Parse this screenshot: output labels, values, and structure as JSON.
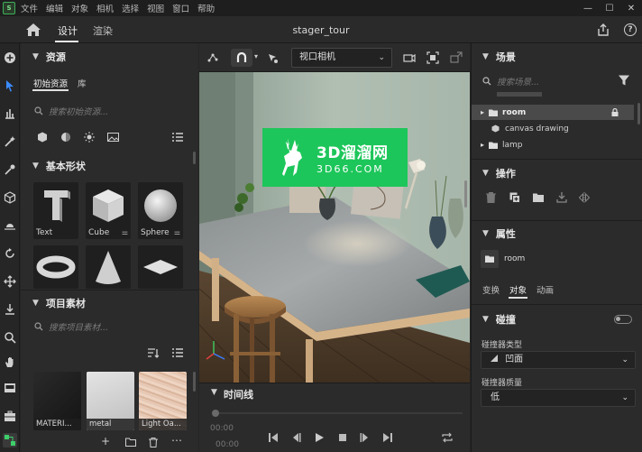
{
  "app": {
    "logo_text": "S",
    "menu": [
      "文件",
      "编辑",
      "对象",
      "相机",
      "选择",
      "视图",
      "窗口",
      "帮助"
    ],
    "window_controls": [
      "—",
      "☐",
      "✕"
    ]
  },
  "topbar": {
    "tabs": [
      "设计",
      "渲染"
    ],
    "scene_name": "stager_tour"
  },
  "assets": {
    "title": "资源",
    "sub_tabs": [
      "初始资源",
      "库"
    ],
    "search_placeholder": "搜索初始资源...",
    "basic_shapes_title": "基本形状",
    "shapes": [
      "Text",
      "Cube",
      "Sphere"
    ],
    "project_title": "项目素材",
    "project_search_placeholder": "搜索项目素材...",
    "materials": [
      "MATERI...",
      "metal",
      "Light Oa..."
    ]
  },
  "viewport": {
    "camera": "视口相机",
    "watermark_main": "3D溜溜网",
    "watermark_sub": "3D66.COM"
  },
  "timeline": {
    "title": "时间线",
    "time_current": "00:00",
    "time_total": "00:00"
  },
  "scene": {
    "title": "场景",
    "search_placeholder": "搜索场景...",
    "items": [
      {
        "label": "room",
        "selected": true
      },
      {
        "label": "canvas drawing",
        "selected": false
      },
      {
        "label": "lamp",
        "selected": false
      }
    ]
  },
  "actions": {
    "title": "操作"
  },
  "properties": {
    "title": "属性",
    "object_name": "room",
    "tabs": [
      "变换",
      "对象",
      "动画"
    ],
    "collision_title": "碰撞",
    "collider_type_label": "碰撞器类型",
    "collider_type_value": "凹面",
    "collider_quality_label": "碰撞器质量",
    "collider_quality_value": "低"
  },
  "colors": {
    "accent_green": "#1dc65a",
    "selected_row": "#4a4a4a",
    "panel_bg": "#2b2b2b"
  }
}
